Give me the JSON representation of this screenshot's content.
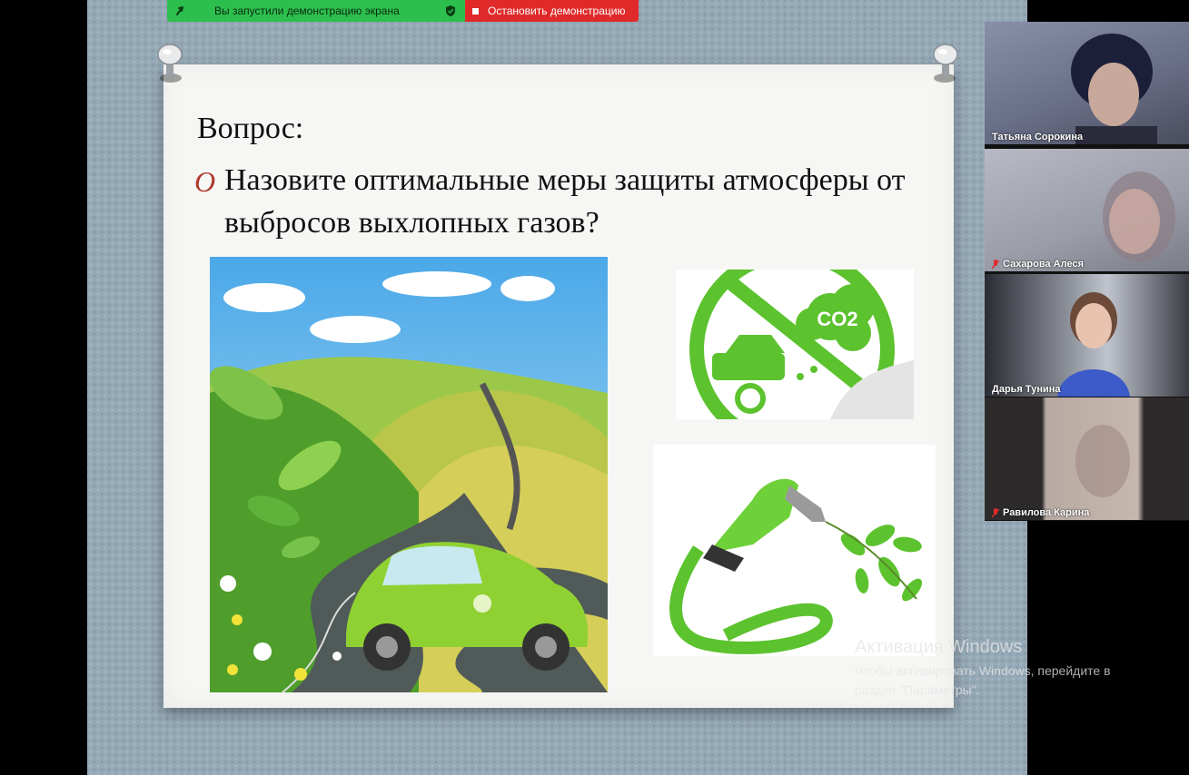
{
  "share_bar": {
    "status_text": "Вы запустили демонстрацию экрана",
    "stop_label": "Остановить демонстрацию",
    "status_color": "#2dbf4d",
    "stop_color": "#e02a2a"
  },
  "slide": {
    "title": "Вопрос:",
    "bullet_marker": "O",
    "bullet_text": "Назовите оптимальные меры защиты атмосферы от выбросов выхлопных газов?",
    "images": {
      "car_landscape": "green-car-landscape",
      "no_co2_sign": "no-co2-emissions-sign",
      "fuel_nozzle": "green-fuel-nozzle-leaves"
    },
    "sign_text": "CO2"
  },
  "participants": [
    {
      "name": "Татьяна Сорокина",
      "mic_off": false
    },
    {
      "name": "Сахарова Алеся",
      "mic_off": true
    },
    {
      "name": "Дарья Тунина",
      "mic_off": false
    },
    {
      "name": "Равилова Карина",
      "mic_off": true
    }
  ],
  "watermark": {
    "title": "Активация Windows",
    "line1": "Чтобы активировать Windows, перейдите в",
    "line2": "раздел \"Параметры\"."
  }
}
